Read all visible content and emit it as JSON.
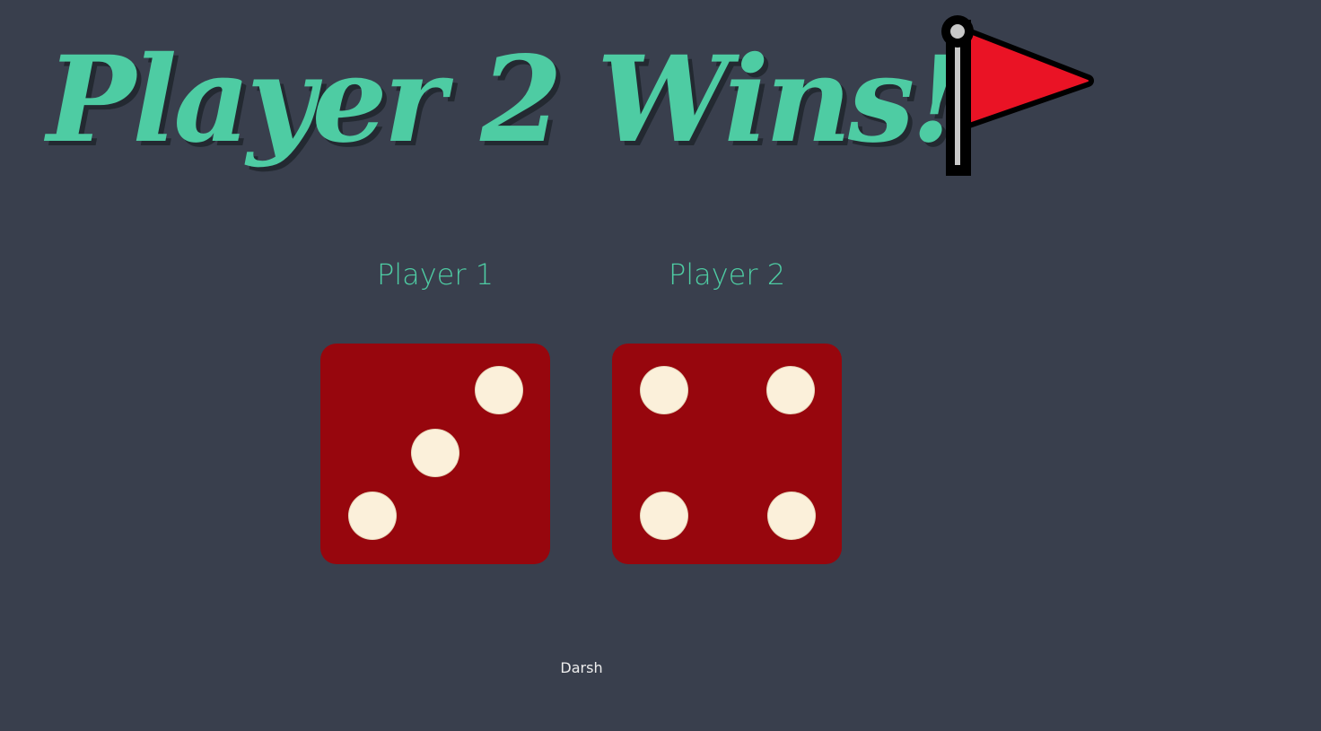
{
  "title": {
    "text": "Player 2 Wins!",
    "flag_icon": "red-flag-icon"
  },
  "players": [
    {
      "label": "Player 1",
      "die_value": 3
    },
    {
      "label": "Player 2",
      "die_value": 4
    }
  ],
  "footer": {
    "text": "Darsh"
  },
  "colors": {
    "background": "#393f4d",
    "accent": "#4ecca3",
    "die": "#97060d",
    "pip": "#fbf0da",
    "flag": "#ea1325"
  }
}
